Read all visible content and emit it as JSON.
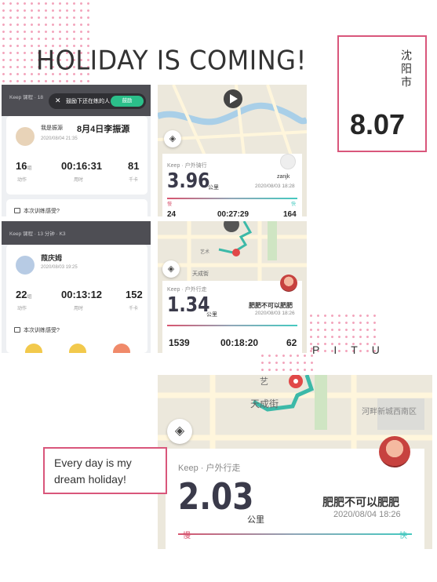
{
  "headline": "HOLIDAY IS COMING!",
  "city": {
    "name": "沈阳市",
    "date": "8.07"
  },
  "quote": "Every day is my dream holiday!",
  "brand": "PITU",
  "colors": {
    "accent_pink": "#d9567b",
    "keep_green": "#2bbf8a"
  },
  "panel1": {
    "keep_line": "Keep 课程 · 18",
    "popup": {
      "close": "✕",
      "text": "鼓励下还在练的人",
      "button": "鼓励"
    },
    "user": "我是振源",
    "title": "8月4日李振源",
    "date": "2020/08/04 21:35",
    "stats": [
      {
        "value": "16",
        "unit": "组",
        "label": "动作"
      },
      {
        "value": "00:16:31",
        "unit": "",
        "label": "用时"
      },
      {
        "value": "81",
        "unit": "",
        "label": "千卡"
      }
    ],
    "feel": "本次训练感受?"
  },
  "panel2": {
    "keep_type": "Keep · 户外骑行",
    "distance": "3.96",
    "unit": "公里",
    "user": "zanjk",
    "date": "2020/08/03 18:28",
    "slow": "慢",
    "fast": "快",
    "peek_stats": [
      "24",
      "00:27:29",
      "164"
    ]
  },
  "panel3": {
    "keep_line": "Keep 课程 · 13 分钟 · K3",
    "user": "葭庆姆",
    "date": "2020/08/03 19:25",
    "stats": [
      {
        "value": "22",
        "unit": "组",
        "label": "动作"
      },
      {
        "value": "00:13:12",
        "unit": "",
        "label": "用时"
      },
      {
        "value": "152",
        "unit": "",
        "label": "千卡"
      }
    ],
    "feel": "本次训练感受?"
  },
  "panel4": {
    "map_label": "天成街",
    "map_label2": "艺术",
    "keep_type": "Keep · 户外行走",
    "distance": "1.34",
    "unit": "公里",
    "user": "肥肥不可以肥肥",
    "date": "2020/08/03 18:26",
    "stats": [
      "1539",
      "00:18:20",
      "62"
    ]
  },
  "panel5": {
    "map_label": "天成街",
    "map_label2": "艺",
    "map_label3": "河畔新城西南区",
    "keep_type": "Keep · 户外行走",
    "distance": "2.03",
    "unit": "公里",
    "user": "肥肥不可以肥肥",
    "date": "2020/08/04 18:26",
    "slow": "慢",
    "fast": "快"
  }
}
